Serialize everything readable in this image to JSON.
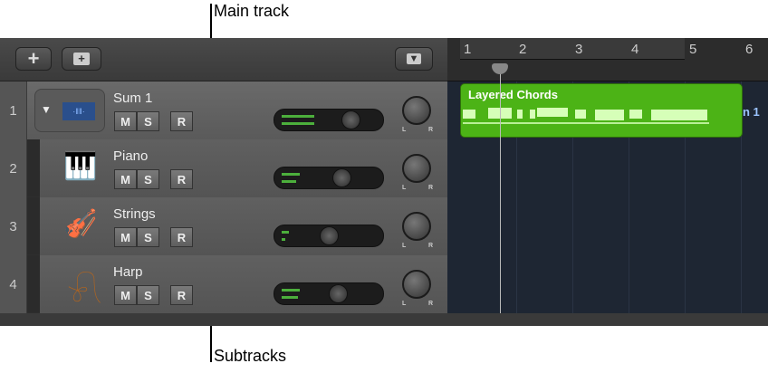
{
  "callouts": {
    "main_track": "Main track",
    "subtracks": "Subtracks"
  },
  "header": {
    "add_icon": "+",
    "add_stack_icon": "+"
  },
  "tracks": [
    {
      "number": "1",
      "name": "Sum 1",
      "mute": "M",
      "solo": "S",
      "record": "R",
      "pan_l": "L",
      "pan_r": "R"
    },
    {
      "number": "2",
      "name": "Piano",
      "mute": "M",
      "solo": "S",
      "record": "R",
      "pan_l": "L",
      "pan_r": "R"
    },
    {
      "number": "3",
      "name": "Strings",
      "mute": "M",
      "solo": "S",
      "record": "R",
      "pan_l": "L",
      "pan_r": "R"
    },
    {
      "number": "4",
      "name": "Harp",
      "mute": "M",
      "solo": "S",
      "record": "R",
      "pan_l": "L",
      "pan_r": "R"
    }
  ],
  "ruler": {
    "bars": [
      "1",
      "2",
      "3",
      "4",
      "5",
      "6"
    ]
  },
  "region": {
    "name": "Layered Chords",
    "overflow_label": "n 1",
    "color": "#4cb316"
  }
}
